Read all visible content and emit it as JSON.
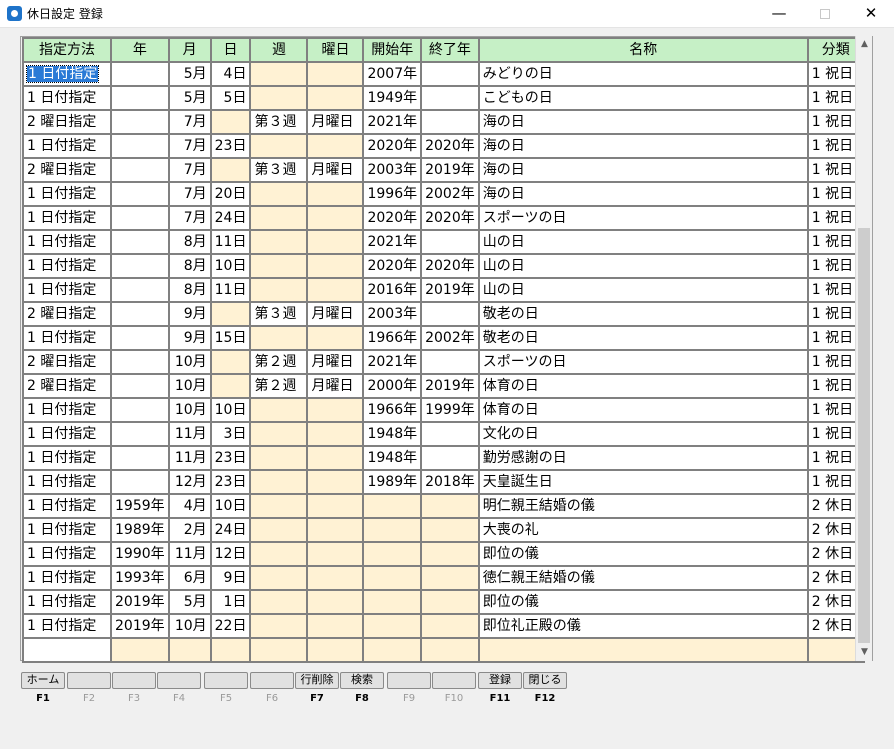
{
  "window": {
    "title": "休日設定 登録",
    "minimize": "—",
    "maximize": "",
    "close": "✕"
  },
  "grid": {
    "headers": [
      "指定方法",
      "年",
      "月",
      "日",
      "週",
      "曜日",
      "開始年",
      "終了年",
      "名称",
      "分類"
    ],
    "rows": [
      [
        "1 日付指定",
        "",
        "5月",
        "4日",
        "",
        "",
        "2007年",
        "",
        "みどりの日",
        "1 祝日"
      ],
      [
        "1 日付指定",
        "",
        "5月",
        "5日",
        "",
        "",
        "1949年",
        "",
        "こどもの日",
        "1 祝日"
      ],
      [
        "2 曜日指定",
        "",
        "7月",
        "",
        "第３週",
        "月曜日",
        "2021年",
        "",
        "海の日",
        "1 祝日"
      ],
      [
        "1 日付指定",
        "",
        "7月",
        "23日",
        "",
        "",
        "2020年",
        "2020年",
        "海の日",
        "1 祝日"
      ],
      [
        "2 曜日指定",
        "",
        "7月",
        "",
        "第３週",
        "月曜日",
        "2003年",
        "2019年",
        "海の日",
        "1 祝日"
      ],
      [
        "1 日付指定",
        "",
        "7月",
        "20日",
        "",
        "",
        "1996年",
        "2002年",
        "海の日",
        "1 祝日"
      ],
      [
        "1 日付指定",
        "",
        "7月",
        "24日",
        "",
        "",
        "2020年",
        "2020年",
        "スポーツの日",
        "1 祝日"
      ],
      [
        "1 日付指定",
        "",
        "8月",
        "11日",
        "",
        "",
        "2021年",
        "",
        "山の日",
        "1 祝日"
      ],
      [
        "1 日付指定",
        "",
        "8月",
        "10日",
        "",
        "",
        "2020年",
        "2020年",
        "山の日",
        "1 祝日"
      ],
      [
        "1 日付指定",
        "",
        "8月",
        "11日",
        "",
        "",
        "2016年",
        "2019年",
        "山の日",
        "1 祝日"
      ],
      [
        "2 曜日指定",
        "",
        "9月",
        "",
        "第３週",
        "月曜日",
        "2003年",
        "",
        "敬老の日",
        "1 祝日"
      ],
      [
        "1 日付指定",
        "",
        "9月",
        "15日",
        "",
        "",
        "1966年",
        "2002年",
        "敬老の日",
        "1 祝日"
      ],
      [
        "2 曜日指定",
        "",
        "10月",
        "",
        "第２週",
        "月曜日",
        "2021年",
        "",
        "スポーツの日",
        "1 祝日"
      ],
      [
        "2 曜日指定",
        "",
        "10月",
        "",
        "第２週",
        "月曜日",
        "2000年",
        "2019年",
        "体育の日",
        "1 祝日"
      ],
      [
        "1 日付指定",
        "",
        "10月",
        "10日",
        "",
        "",
        "1966年",
        "1999年",
        "体育の日",
        "1 祝日"
      ],
      [
        "1 日付指定",
        "",
        "11月",
        "3日",
        "",
        "",
        "1948年",
        "",
        "文化の日",
        "1 祝日"
      ],
      [
        "1 日付指定",
        "",
        "11月",
        "23日",
        "",
        "",
        "1948年",
        "",
        "勤労感謝の日",
        "1 祝日"
      ],
      [
        "1 日付指定",
        "",
        "12月",
        "23日",
        "",
        "",
        "1989年",
        "2018年",
        "天皇誕生日",
        "1 祝日"
      ],
      [
        "1 日付指定",
        "1959年",
        "4月",
        "10日",
        "",
        "",
        "",
        "",
        "明仁親王結婚の儀",
        "2 休日"
      ],
      [
        "1 日付指定",
        "1989年",
        "2月",
        "24日",
        "",
        "",
        "",
        "",
        "大喪の礼",
        "2 休日"
      ],
      [
        "1 日付指定",
        "1990年",
        "11月",
        "12日",
        "",
        "",
        "",
        "",
        "即位の儀",
        "2 休日"
      ],
      [
        "1 日付指定",
        "1993年",
        "6月",
        "9日",
        "",
        "",
        "",
        "",
        "徳仁親王結婚の儀",
        "2 休日"
      ],
      [
        "1 日付指定",
        "2019年",
        "5月",
        "1日",
        "",
        "",
        "",
        "",
        "即位の儀",
        "2 休日"
      ],
      [
        "1 日付指定",
        "2019年",
        "10月",
        "22日",
        "",
        "",
        "",
        "",
        "即位礼正殿の儀",
        "2 休日"
      ],
      [
        "",
        "",
        "",
        "",
        "",
        "",
        "",
        "",
        "",
        ""
      ]
    ]
  },
  "function_keys": [
    {
      "label": "ホーム",
      "key": "F1",
      "active": true
    },
    {
      "label": "",
      "key": "F2",
      "active": false
    },
    {
      "label": "",
      "key": "F3",
      "active": false
    },
    {
      "label": "",
      "key": "F4",
      "active": false
    },
    {
      "label": "",
      "key": "F5",
      "active": false
    },
    {
      "label": "",
      "key": "F6",
      "active": false
    },
    {
      "label": "行削除",
      "key": "F7",
      "active": true
    },
    {
      "label": "検索",
      "key": "F8",
      "active": true
    },
    {
      "label": "",
      "key": "F9",
      "active": false
    },
    {
      "label": "",
      "key": "F10",
      "active": false
    },
    {
      "label": "登録",
      "key": "F11",
      "active": true
    },
    {
      "label": "閉じる",
      "key": "F12",
      "active": true
    }
  ],
  "colors": {
    "header_bg": "#c6f0c6",
    "input_bg": "#fff2d4",
    "selection": "#2a7ad6"
  }
}
